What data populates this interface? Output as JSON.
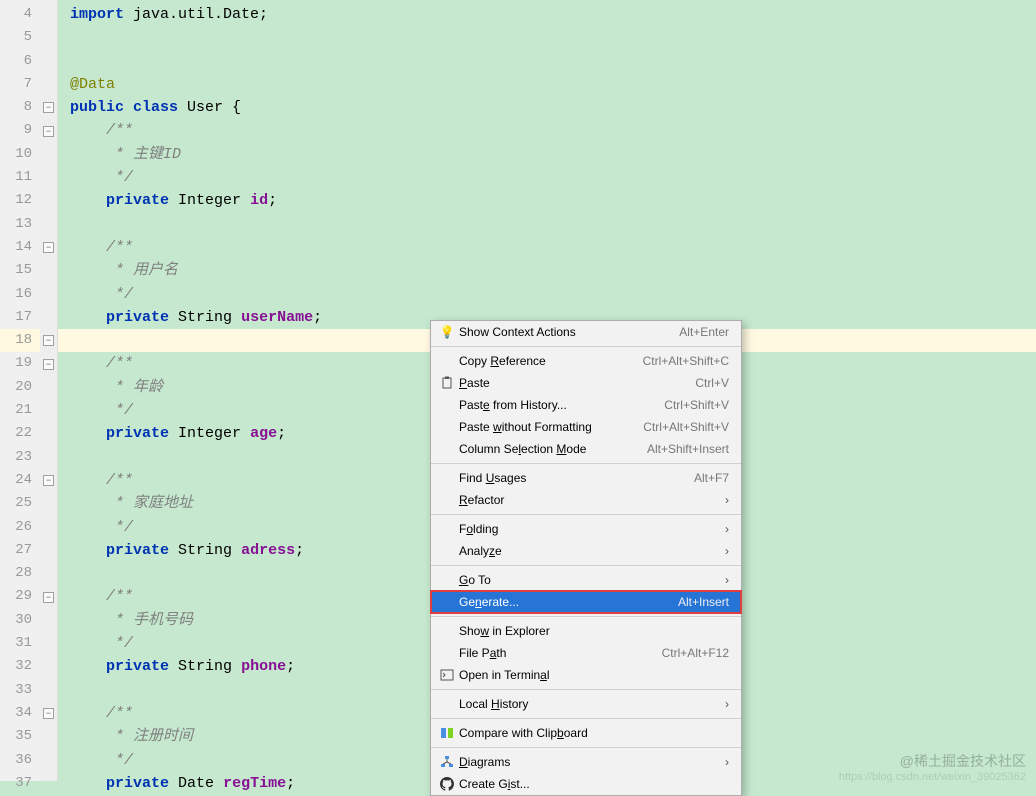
{
  "gutter_start": 4,
  "gutter_end": 37,
  "highlighted_line": 18,
  "code_lines": [
    {
      "n": 4,
      "html": "<span class='kw'>import</span> <span class='norm'>java.util.Date;</span>"
    },
    {
      "n": 5,
      "html": ""
    },
    {
      "n": 6,
      "html": ""
    },
    {
      "n": 7,
      "html": "<span class='ann'>@Data</span>"
    },
    {
      "n": 8,
      "html": "<span class='kw'>public class</span> <span class='norm'>User {</span>"
    },
    {
      "n": 9,
      "html": "    <span class='com'>/**</span>"
    },
    {
      "n": 10,
      "html": "    <span class='com'> * 主键ID</span>"
    },
    {
      "n": 11,
      "html": "    <span class='com'> */</span>"
    },
    {
      "n": 12,
      "html": "    <span class='kw'>private</span> <span class='norm'>Integer</span> <span class='fld'>id</span><span class='norm'>;</span>"
    },
    {
      "n": 13,
      "html": ""
    },
    {
      "n": 14,
      "html": "    <span class='com'>/**</span>"
    },
    {
      "n": 15,
      "html": "    <span class='com'> * 用户名</span>"
    },
    {
      "n": 16,
      "html": "    <span class='com'> */</span>"
    },
    {
      "n": 17,
      "html": "    <span class='kw'>private</span> <span class='norm'>String</span> <span class='fld'>userName</span><span class='norm'>;</span>"
    },
    {
      "n": 18,
      "html": ""
    },
    {
      "n": 19,
      "html": "    <span class='com'>/**</span>"
    },
    {
      "n": 20,
      "html": "    <span class='com'> * 年龄</span>"
    },
    {
      "n": 21,
      "html": "    <span class='com'> */</span>"
    },
    {
      "n": 22,
      "html": "    <span class='kw'>private</span> <span class='norm'>Integer</span> <span class='fld'>age</span><span class='norm'>;</span>"
    },
    {
      "n": 23,
      "html": ""
    },
    {
      "n": 24,
      "html": "    <span class='com'>/**</span>"
    },
    {
      "n": 25,
      "html": "    <span class='com'> * 家庭地址</span>"
    },
    {
      "n": 26,
      "html": "    <span class='com'> */</span>"
    },
    {
      "n": 27,
      "html": "    <span class='kw'>private</span> <span class='norm'>String</span> <span class='fld'>adress</span><span class='norm'>;</span>"
    },
    {
      "n": 28,
      "html": ""
    },
    {
      "n": 29,
      "html": "    <span class='com'>/**</span>"
    },
    {
      "n": 30,
      "html": "    <span class='com'> * 手机号码</span>"
    },
    {
      "n": 31,
      "html": "    <span class='com'> */</span>"
    },
    {
      "n": 32,
      "html": "    <span class='kw'>private</span> <span class='norm'>String</span> <span class='fld'>phone</span><span class='norm'>;</span>"
    },
    {
      "n": 33,
      "html": ""
    },
    {
      "n": 34,
      "html": "    <span class='com'>/**</span>"
    },
    {
      "n": 35,
      "html": "    <span class='com'> * 注册时间</span>"
    },
    {
      "n": 36,
      "html": "    <span class='com'> */</span>"
    },
    {
      "n": 37,
      "html": "    <span class='kw'>private</span> <span class='norm'>Date</span> <span class='fld'>regTime</span><span class='norm'>;</span>"
    }
  ],
  "fold_marks": [
    8,
    9,
    14,
    18,
    19,
    24,
    29,
    34
  ],
  "menu": [
    {
      "type": "item",
      "icon": "bulb",
      "label": "Show Context Actions",
      "shortcut": "Alt+Enter"
    },
    {
      "type": "sep"
    },
    {
      "type": "item",
      "icon": "",
      "label": "Copy <span class='u'>R</span>eference",
      "shortcut": "Ctrl+Alt+Shift+C"
    },
    {
      "type": "item",
      "icon": "paste",
      "label": "<span class='u'>P</span>aste",
      "shortcut": "Ctrl+V"
    },
    {
      "type": "item",
      "icon": "",
      "label": "Past<span class='u'>e</span> from History...",
      "shortcut": "Ctrl+Shift+V"
    },
    {
      "type": "item",
      "icon": "",
      "label": "Paste <span class='u'>w</span>ithout Formatting",
      "shortcut": "Ctrl+Alt+Shift+V"
    },
    {
      "type": "item",
      "icon": "",
      "label": "Column Se<span class='u'>l</span>ection <span class='u'>M</span>ode",
      "shortcut": "Alt+Shift+Insert"
    },
    {
      "type": "sep"
    },
    {
      "type": "item",
      "icon": "",
      "label": "Find <span class='u'>U</span>sages",
      "shortcut": "Alt+F7"
    },
    {
      "type": "item",
      "icon": "",
      "label": "<span class='u'>R</span>efactor",
      "submenu": true
    },
    {
      "type": "sep"
    },
    {
      "type": "item",
      "icon": "",
      "label": "F<span class='u'>o</span>lding",
      "submenu": true
    },
    {
      "type": "item",
      "icon": "",
      "label": "Analy<span class='u'>z</span>e",
      "submenu": true
    },
    {
      "type": "sep"
    },
    {
      "type": "item",
      "icon": "",
      "label": "<span class='u'>G</span>o To",
      "submenu": true
    },
    {
      "type": "item",
      "icon": "",
      "label": "Ge<span class='u'>n</span>erate...",
      "shortcut": "Alt+Insert",
      "selected": true,
      "highlighted": true
    },
    {
      "type": "sep"
    },
    {
      "type": "item",
      "icon": "",
      "label": "Sho<span class='u'>w</span> in Explorer"
    },
    {
      "type": "item",
      "icon": "",
      "label": "File P<span class='u'>a</span>th",
      "shortcut": "Ctrl+Alt+F12"
    },
    {
      "type": "item",
      "icon": "terminal",
      "label": "Open in Termin<span class='u'>a</span>l"
    },
    {
      "type": "sep"
    },
    {
      "type": "item",
      "icon": "",
      "label": "Local <span class='u'>H</span>istory",
      "submenu": true
    },
    {
      "type": "sep"
    },
    {
      "type": "item",
      "icon": "compare",
      "label": "Compare with Clip<span class='u'>b</span>oard"
    },
    {
      "type": "sep"
    },
    {
      "type": "item",
      "icon": "diagram",
      "label": "<span class='u'>D</span>iagrams",
      "submenu": true
    },
    {
      "type": "item",
      "icon": "github",
      "label": "Create G<span class='u'>i</span>st..."
    }
  ],
  "watermark": "@稀土掘金技术社区",
  "watermark2": "https://blog.csdn.net/weixin_39025362"
}
